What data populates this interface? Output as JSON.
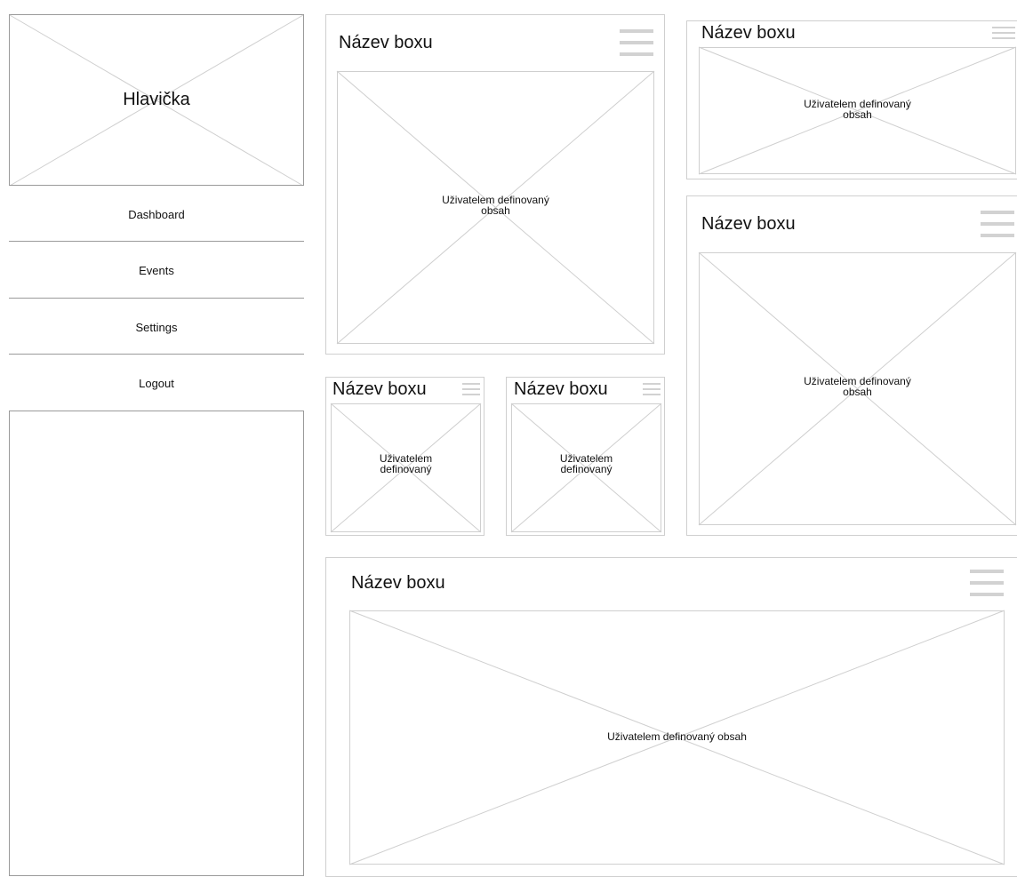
{
  "sidebar": {
    "header_title": "Hlavička",
    "nav_items": [
      {
        "label": "Dashboard"
      },
      {
        "label": "Events"
      },
      {
        "label": "Settings"
      },
      {
        "label": "Logout"
      }
    ]
  },
  "boxes": {
    "main_left": {
      "title": "Název boxu",
      "content": "Uživatelem definovaný\nobsah"
    },
    "top_right": {
      "title": "Název boxu",
      "content": "Uživatelem definovaný\nobsah"
    },
    "right_tall": {
      "title": "Název boxu",
      "content": "Uživatelem definovaný\nobsah"
    },
    "small_1": {
      "title": "Název boxu",
      "content": "Uživatelem\ndefinovaný"
    },
    "small_2": {
      "title": "Název boxu",
      "content": "Uživatelem\ndefinovaný"
    },
    "wide_bottom": {
      "title": "Název boxu",
      "content": "Uživatelem definovaný obsah"
    }
  },
  "colors": {
    "placeholder_stroke": "#cfcfcf",
    "sidebar_border": "#9a9a9a",
    "menu_icon": "#d2d2d2"
  },
  "icons": {
    "box_menu": "hamburger-menu-icon"
  }
}
